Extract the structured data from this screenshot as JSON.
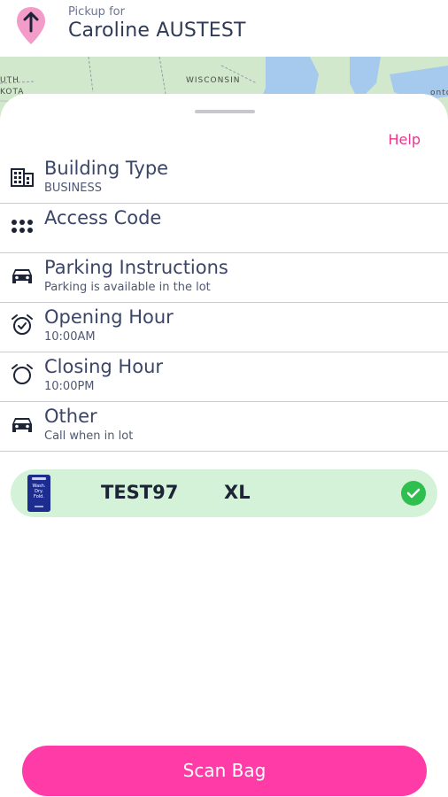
{
  "header": {
    "pickup_label": "Pickup for",
    "customer_name": "Caroline AUSTEST",
    "pin_icon": "arrow-up-pin-icon"
  },
  "map": {
    "labels": [
      "UTH",
      "KOTA",
      "WISCONSIN",
      "onto"
    ]
  },
  "sheet": {
    "help_label": "Help",
    "rows": [
      {
        "icon": "building-icon",
        "title": "Building Type",
        "subtitle": "BUSINESS"
      },
      {
        "icon": "keypad-icon",
        "title": "Access Code",
        "subtitle": ""
      },
      {
        "icon": "car-icon",
        "title": "Parking Instructions",
        "subtitle": "Parking is available in the lot"
      },
      {
        "icon": "alarm-check-icon",
        "title": "Opening Hour",
        "subtitle": "10:00AM"
      },
      {
        "icon": "alarm-icon",
        "title": "Closing Hour",
        "subtitle": "10:00PM"
      },
      {
        "icon": "car-icon",
        "title": "Other",
        "subtitle": "Call when in lot"
      }
    ]
  },
  "bag": {
    "id": "TEST97",
    "size": "XL",
    "image_text": "Wash. Dry. Fold.",
    "status_icon": "check-circle-icon"
  },
  "actions": {
    "scan_label": "Scan Bag"
  },
  "colors": {
    "accent": "#ff3ba7",
    "help": "#e8368f",
    "bag_bg": "#d4f2d7",
    "check": "#2fbf4f"
  }
}
